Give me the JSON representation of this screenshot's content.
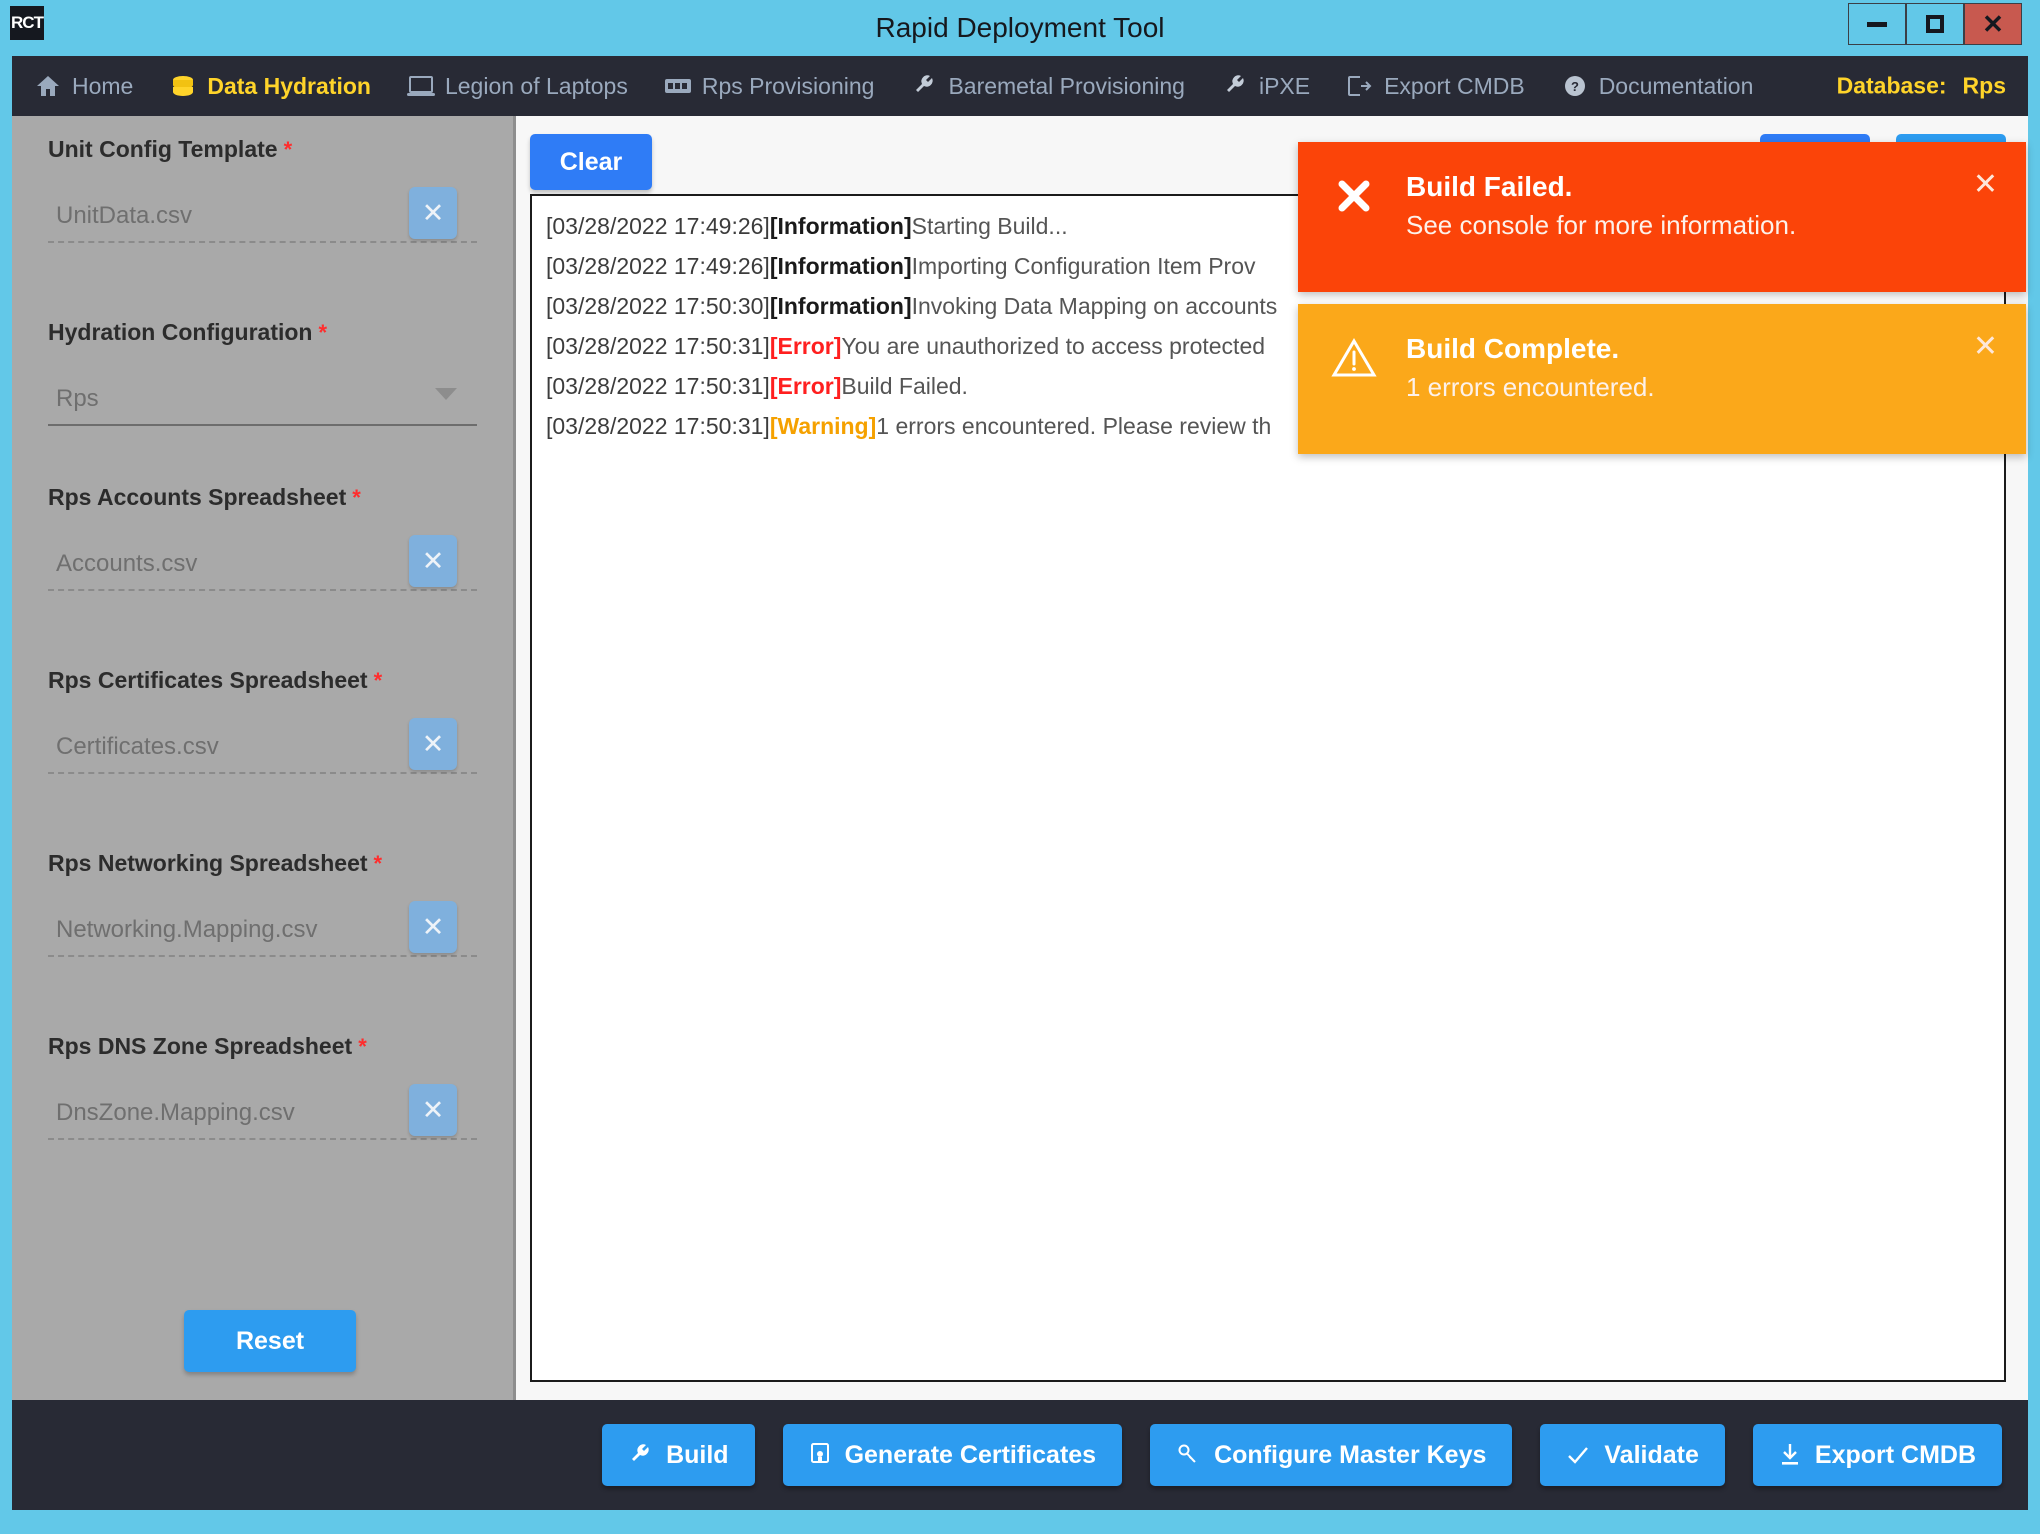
{
  "window": {
    "title": "Rapid Deployment Tool",
    "logo_text": "RCT",
    "controls": {
      "minimize": "minimize",
      "maximize": "maximize",
      "close": "close"
    }
  },
  "nav": {
    "items": [
      {
        "label": "Home",
        "icon": "home-icon",
        "active": false
      },
      {
        "label": "Data Hydration",
        "icon": "database-stack-icon",
        "active": true
      },
      {
        "label": "Legion of Laptops",
        "icon": "laptop-icon",
        "active": false
      },
      {
        "label": "Rps Provisioning",
        "icon": "server-rack-icon",
        "active": false
      },
      {
        "label": "Baremetal Provisioning",
        "icon": "wrench-icon",
        "active": false
      },
      {
        "label": "iPXE",
        "icon": "wrench-icon",
        "active": false
      },
      {
        "label": "Export CMDB",
        "icon": "export-icon",
        "active": false
      },
      {
        "label": "Documentation",
        "icon": "help-circle-icon",
        "active": false
      }
    ],
    "database_label": "Database:",
    "database_value": "Rps",
    "accent_color": "#ffd42a",
    "inactive_color": "#9aa9bd",
    "background_color": "#282a35"
  },
  "sidebar": {
    "fields": [
      {
        "label": "Unit Config Template",
        "required_marker": "*",
        "value": "UnitData.csv",
        "placeholder": "UnitData.csv",
        "control": "clear-button",
        "clear_label": "✕"
      },
      {
        "label": "Hydration Configuration",
        "required_marker": "*",
        "value": "Rps",
        "placeholder": "Rps",
        "control": "dropdown",
        "options": [
          "Rps"
        ]
      },
      {
        "label": "Rps Accounts Spreadsheet",
        "required_marker": "*",
        "value": "Accounts.csv",
        "placeholder": "Accounts.csv",
        "control": "clear-button",
        "clear_label": "✕"
      },
      {
        "label": "Rps Certificates Spreadsheet",
        "required_marker": "*",
        "value": "Certificates.csv",
        "placeholder": "Certificates.csv",
        "control": "clear-button",
        "clear_label": "✕"
      },
      {
        "label": "Rps Networking Spreadsheet",
        "required_marker": "*",
        "value": "Networking.Mapping.csv",
        "placeholder": "Networking.Mapping.csv",
        "control": "clear-button",
        "clear_label": "✕"
      },
      {
        "label": "Rps DNS Zone Spreadsheet",
        "required_marker": "*",
        "value": "DnsZone.Mapping.csv",
        "placeholder": "DnsZone.Mapping.csv",
        "control": "clear-button",
        "clear_label": "✕"
      }
    ],
    "reset_label": "Reset"
  },
  "console": {
    "clear_label": "Clear",
    "lines": [
      {
        "timestamp": "[03/28/2022 17:49:26]",
        "level": "Information",
        "level_text": "[Information]",
        "message": "Starting Build..."
      },
      {
        "timestamp": "[03/28/2022 17:49:26]",
        "level": "Information",
        "level_text": "[Information]",
        "message": "Importing Configuration Item Prov"
      },
      {
        "timestamp": "[03/28/2022 17:50:30]",
        "level": "Information",
        "level_text": "[Information]",
        "message": "Invoking Data Mapping on accounts"
      },
      {
        "timestamp": "[03/28/2022 17:50:31]",
        "level": "Error",
        "level_text": "[Error]",
        "message": "You are unauthorized to access protected"
      },
      {
        "timestamp": "[03/28/2022 17:50:31]",
        "level": "Error",
        "level_text": "[Error]",
        "message": "Build Failed."
      },
      {
        "timestamp": "[03/28/2022 17:50:31]",
        "level": "Warning",
        "level_text": "[Warning]",
        "message": "1 errors encountered. Please review th"
      }
    ]
  },
  "toasts": [
    {
      "type": "error",
      "icon": "x-mark-icon",
      "title": "Build Failed.",
      "message": "See console for more information.",
      "close_label": "✕",
      "color": "#fb4409"
    },
    {
      "type": "warning",
      "icon": "warning-triangle-icon",
      "title": "Build Complete.",
      "message": "1 errors encountered.",
      "close_label": "✕",
      "color": "#fba81a"
    }
  ],
  "actions": [
    {
      "label": "Build",
      "icon": "wrench-icon"
    },
    {
      "label": "Generate Certificates",
      "icon": "certificate-icon"
    },
    {
      "label": "Configure Master Keys",
      "icon": "key-icon"
    },
    {
      "label": "Validate",
      "icon": "check-icon"
    },
    {
      "label": "Export CMDB",
      "icon": "download-icon"
    }
  ]
}
